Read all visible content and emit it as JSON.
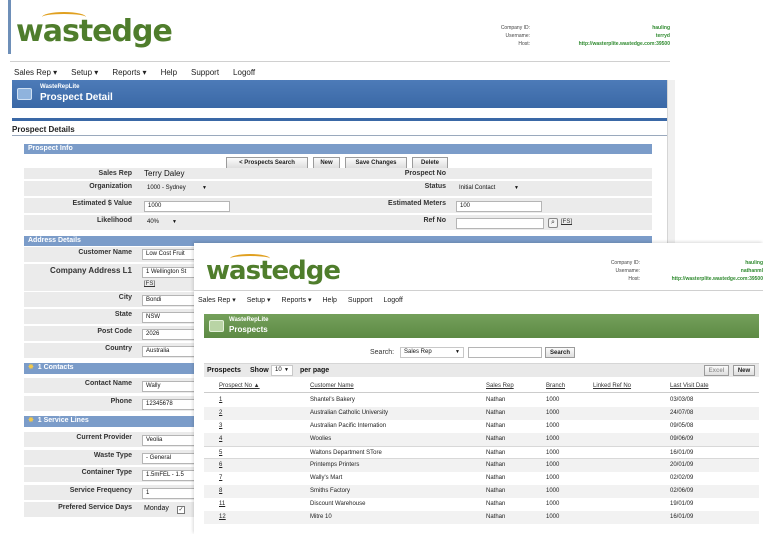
{
  "back": {
    "logo": "wastedge",
    "header": {
      "company_label": "Company ID:",
      "company_value": "hauling",
      "username_label": "Username:",
      "username_value": "terryd",
      "host_label": "Host:",
      "host_value": "http://wasterplite.wastedge.com:39500"
    },
    "menu": [
      "Sales Rep ▾",
      "Setup ▾",
      "Reports ▾",
      "Help",
      "Support",
      "Logoff"
    ],
    "app_name": "WasteRepLite",
    "page_title": "Prospect Detail",
    "section_title": "Prospect Details",
    "prospect_info": {
      "heading": "Prospect Info",
      "buttons": [
        "< Prospects Search",
        "New",
        "Save Changes",
        "Delete"
      ],
      "sales_rep_label": "Sales Rep",
      "sales_rep_value": "Terry Daley",
      "prospect_no_label": "Prospect No",
      "organization_label": "Organization",
      "organization_value": "1000 - Sydney",
      "status_label": "Status",
      "status_value": "Initial Contact",
      "est_value_label": "Estimated $ Value",
      "est_value_value": "1000",
      "est_meters_label": "Estimated Meters",
      "est_meters_value": "100",
      "likelihood_label": "Likelihood",
      "likelihood_value": "40%",
      "ref_no_label": "Ref No",
      "ref_no_value": "",
      "ref_no_link": "[FS]"
    },
    "address": {
      "heading": "Address Details",
      "customer_name_label": "Customer Name",
      "customer_name_value": "Low Cost Fruit",
      "address_label": "Company Address L1",
      "address_value": "1 Wellington St",
      "address_link": "[FS]",
      "city_label": "City",
      "city_value": "Bondi",
      "state_label": "State",
      "state_value": "NSW",
      "postcode_label": "Post Code",
      "postcode_value": "2026",
      "country_label": "Country",
      "country_value": "Australia"
    },
    "contacts": {
      "heading": "1 Contacts",
      "contact_label": "Contact Name",
      "contact_value": "Wally",
      "phone_label": "Phone",
      "phone_value": "12345678"
    },
    "service": {
      "heading": "1 Service Lines",
      "provider_label": "Current Provider",
      "provider_value": "Veolia",
      "waste_label": "Waste Type",
      "waste_value": "- General",
      "container_label": "Container Type",
      "container_value": "1.5mFEL - 1.5",
      "frequency_label": "Service Frequency",
      "frequency_value": "1",
      "days_label": "Prefered Service Days",
      "days_value": "Monday"
    }
  },
  "front": {
    "logo": "wastedge",
    "header": {
      "company_label": "Company ID:",
      "company_value": "hauling",
      "username_label": "Username:",
      "username_value": "nathanml",
      "host_label": "Host:",
      "host_value": "http://wasterplite.wastedge.com:39500"
    },
    "menu": [
      "Sales Rep ▾",
      "Setup ▾",
      "Reports ▾",
      "Help",
      "Support",
      "Logoff"
    ],
    "app_name": "WasteRepLite",
    "page_title": "Prospects",
    "search_label": "Search:",
    "search_field": "Sales Rep",
    "search_button": "Search",
    "list_title": "Prospects",
    "show_label": "Show",
    "show_value": "10",
    "per_page": "per page",
    "excel_button": "Excel",
    "new_button": "New",
    "columns": [
      "Prospect No ▲",
      "Customer Name",
      "Sales Rep",
      "Branch",
      "Linked Ref No",
      "Last Visit Date"
    ],
    "rows": [
      [
        "1",
        "Shantel's Bakery",
        "Nathan",
        "1000",
        "",
        "03/03/08"
      ],
      [
        "2",
        "Australian Catholic University",
        "Nathan",
        "1000",
        "",
        "24/07/08"
      ],
      [
        "3",
        "Australian Pacific Internation",
        "Nathan",
        "1000",
        "",
        "09/05/08"
      ],
      [
        "4",
        "Woolies",
        "Nathan",
        "1000",
        "",
        "09/06/09"
      ],
      [
        "5",
        "Waltons Department STore",
        "Nathan",
        "1000",
        "",
        "16/01/09"
      ],
      [
        "6",
        "Printemps Printers",
        "Nathan",
        "1000",
        "",
        "20/01/09"
      ],
      [
        "7",
        "Wally's Mart",
        "Nathan",
        "1000",
        "",
        "02/02/09"
      ],
      [
        "8",
        "Smiths Factory",
        "Nathan",
        "1000",
        "",
        "02/06/09"
      ],
      [
        "11",
        "Discount Warehouse",
        "Nathan",
        "1000",
        "",
        "19/01/09"
      ],
      [
        "12",
        "Mitre 10",
        "Nathan",
        "1000",
        "",
        "16/01/09"
      ]
    ]
  },
  "colors": {
    "blue_bar": "#3a68a6",
    "green_bar": "#5d8a44",
    "section_head": "#7b9cc9",
    "logo_green": "#4f7d2c"
  }
}
